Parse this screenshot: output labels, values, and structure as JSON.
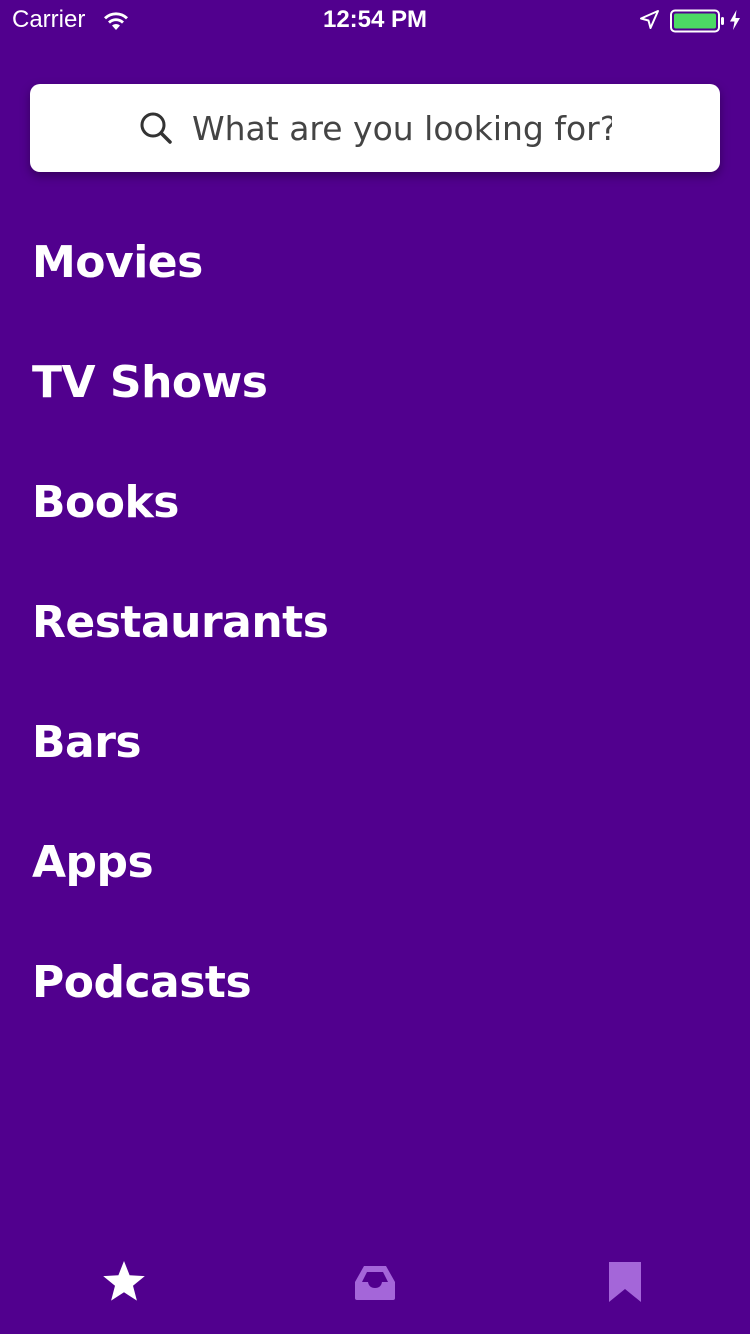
{
  "status_bar": {
    "carrier": "Carrier",
    "time": "12:54 PM",
    "battery_color": "#4CD964"
  },
  "search": {
    "placeholder": "What are you looking for?",
    "icon": "search-icon"
  },
  "categories": [
    {
      "label": "Movies"
    },
    {
      "label": "TV Shows"
    },
    {
      "label": "Books"
    },
    {
      "label": "Restaurants"
    },
    {
      "label": "Bars"
    },
    {
      "label": "Apps"
    },
    {
      "label": "Podcasts"
    }
  ],
  "tab_bar": {
    "tabs": [
      {
        "icon": "star-icon",
        "active": true
      },
      {
        "icon": "inbox-icon",
        "active": false
      },
      {
        "icon": "bookmark-icon",
        "active": false
      }
    ],
    "active_color": "#FFFFFF",
    "inactive_color": "#A466D9"
  },
  "colors": {
    "background": "#51008E",
    "search_background": "#FFFFFF",
    "text": "#FFFFFF"
  }
}
